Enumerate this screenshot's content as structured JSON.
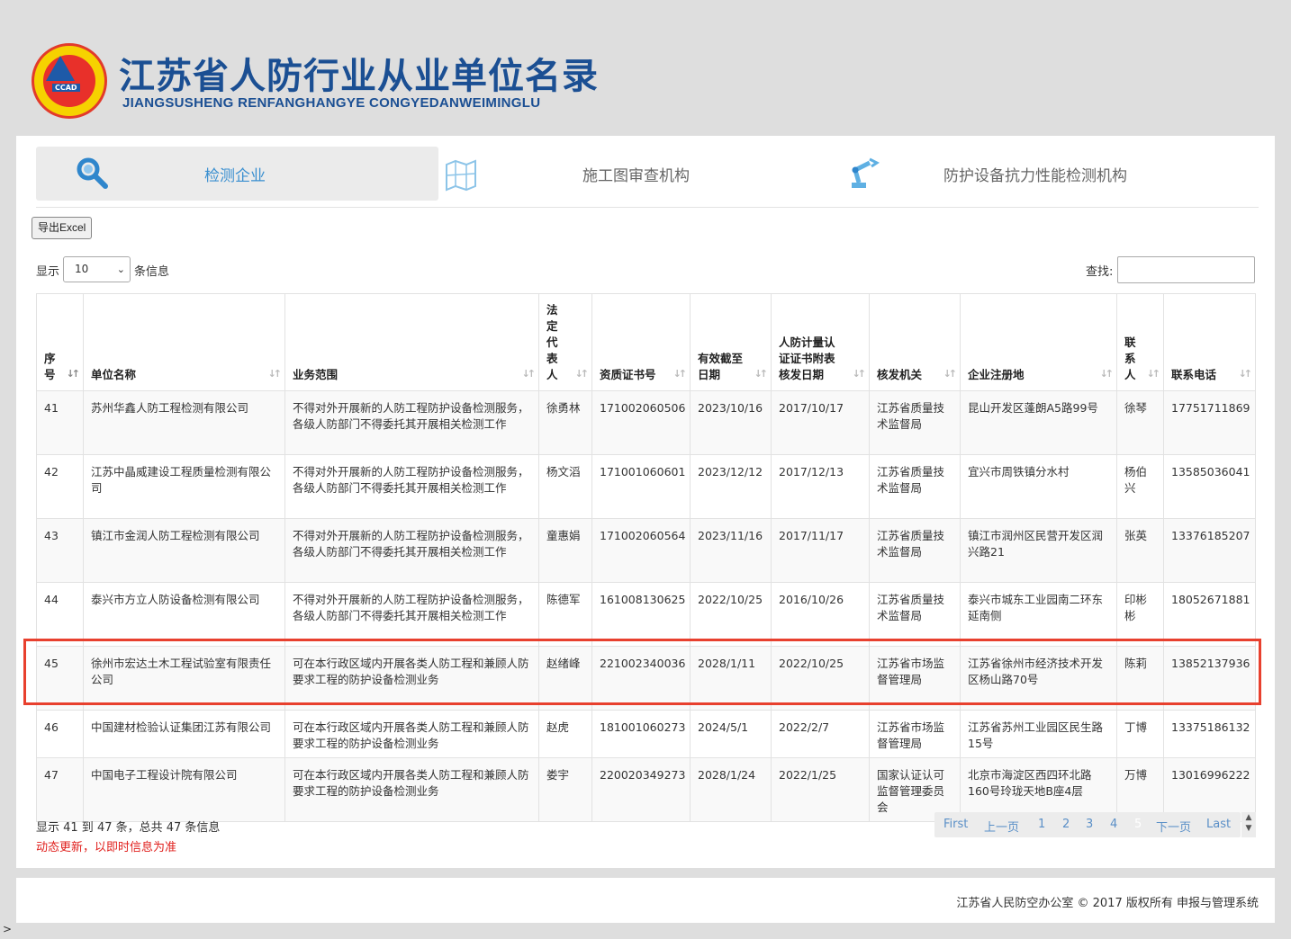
{
  "header": {
    "logo_text": "CCAD",
    "title_cn": "江苏省人防行业从业单位名录",
    "title_en": "JIANGSUSHENG RENFANGHANGYE CONGYEDANWEIMINGLU"
  },
  "tabs": [
    {
      "label": "检测企业",
      "icon": "magnifier-icon",
      "active": true
    },
    {
      "label": "施工图审查机构",
      "icon": "blueprint-map-icon",
      "active": false
    },
    {
      "label": "防护设备抗力性能检测机构",
      "icon": "robot-arm-icon",
      "active": false
    }
  ],
  "toolbar": {
    "export_label": "导出Excel",
    "show_label": "显示",
    "page_size": "10",
    "entries_label": "条信息",
    "search_label": "查找:"
  },
  "table": {
    "columns": [
      "序号",
      "单位名称",
      "业务范围",
      "法定代表人",
      "资质证书号",
      "有效截至日期",
      "人防计量认证证书附表核发日期",
      "核发机关",
      "企业注册地",
      "联系人",
      "联系电话"
    ],
    "rows": [
      [
        "41",
        "苏州华鑫人防工程检测有限公司",
        "不得对外开展新的人防工程防护设备检测服务，各级人防部门不得委托其开展相关检测工作",
        "徐勇林",
        "171002060506",
        "2023/10/16",
        "2017/10/17",
        "江苏省质量技术监督局",
        "昆山开发区蓬朗A5路99号",
        "徐琴",
        "17751711869"
      ],
      [
        "42",
        "江苏中晶威建设工程质量检测有限公司",
        "不得对外开展新的人防工程防护设备检测服务，各级人防部门不得委托其开展相关检测工作",
        "杨文滔",
        "171001060601",
        "2023/12/12",
        "2017/12/13",
        "江苏省质量技术监督局",
        "宜兴市周铁镇分水村",
        "杨伯兴",
        "13585036041"
      ],
      [
        "43",
        "镇江市金润人防工程检测有限公司",
        "不得对外开展新的人防工程防护设备检测服务，各级人防部门不得委托其开展相关检测工作",
        "童惠娟",
        "171002060564",
        "2023/11/16",
        "2017/11/17",
        "江苏省质量技术监督局",
        "镇江市润州区民营开发区润兴路21",
        "张英",
        "13376185207"
      ],
      [
        "44",
        "泰兴市方立人防设备检测有限公司",
        "不得对外开展新的人防工程防护设备检测服务，各级人防部门不得委托其开展相关检测工作",
        "陈德军",
        "161008130625",
        "2022/10/25",
        "2016/10/26",
        "江苏省质量技术监督局",
        "泰兴市城东工业园南二环东延南侧",
        "印彬彬",
        "18052671881"
      ],
      [
        "45",
        "徐州市宏达土木工程试验室有限责任公司",
        "可在本行政区域内开展各类人防工程和兼顾人防要求工程的防护设备检测业务",
        "赵绪峰",
        "221002340036",
        "2028/1/11",
        "2022/10/25",
        "江苏省市场监督管理局",
        "江苏省徐州市经济技术开发区杨山路70号",
        "陈莉",
        "13852137936"
      ],
      [
        "46",
        "中国建材检验认证集团江苏有限公司",
        "可在本行政区域内开展各类人防工程和兼顾人防要求工程的防护设备检测业务",
        "赵虎",
        "181001060273",
        "2024/5/1",
        "2022/2/7",
        "江苏省市场监督管理局",
        "江苏省苏州工业园区民生路15号",
        "丁博",
        "13375186132"
      ],
      [
        "47",
        "中国电子工程设计院有限公司",
        "可在本行政区域内开展各类人防工程和兼顾人防要求工程的防护设备检测业务",
        "娄宇",
        "220020349273",
        "2028/1/24",
        "2022/1/25",
        "国家认证认可监督管理委员会",
        "北京市海淀区西四环北路160号玲珑天地B座4层",
        "万博",
        "13016996222"
      ]
    ]
  },
  "footer_info": {
    "summary": "显示 41 到 47 条，总共 47 条信息",
    "note": "动态更新，以即时信息为准"
  },
  "pagination": {
    "first": "First",
    "prev": "上一页",
    "pages": [
      "1",
      "2",
      "3",
      "4",
      "5"
    ],
    "current": "5",
    "next": "下一页",
    "last": "Last"
  },
  "copyright": "江苏省人民防空办公室 © 2017 版权所有 申报与管理系统",
  "colors": {
    "brand": "#1b4f93",
    "tab_active": "#3a8fd0",
    "link": "#5a8fc7",
    "alert": "#e0201d",
    "highlight_box": "#e8402e"
  }
}
